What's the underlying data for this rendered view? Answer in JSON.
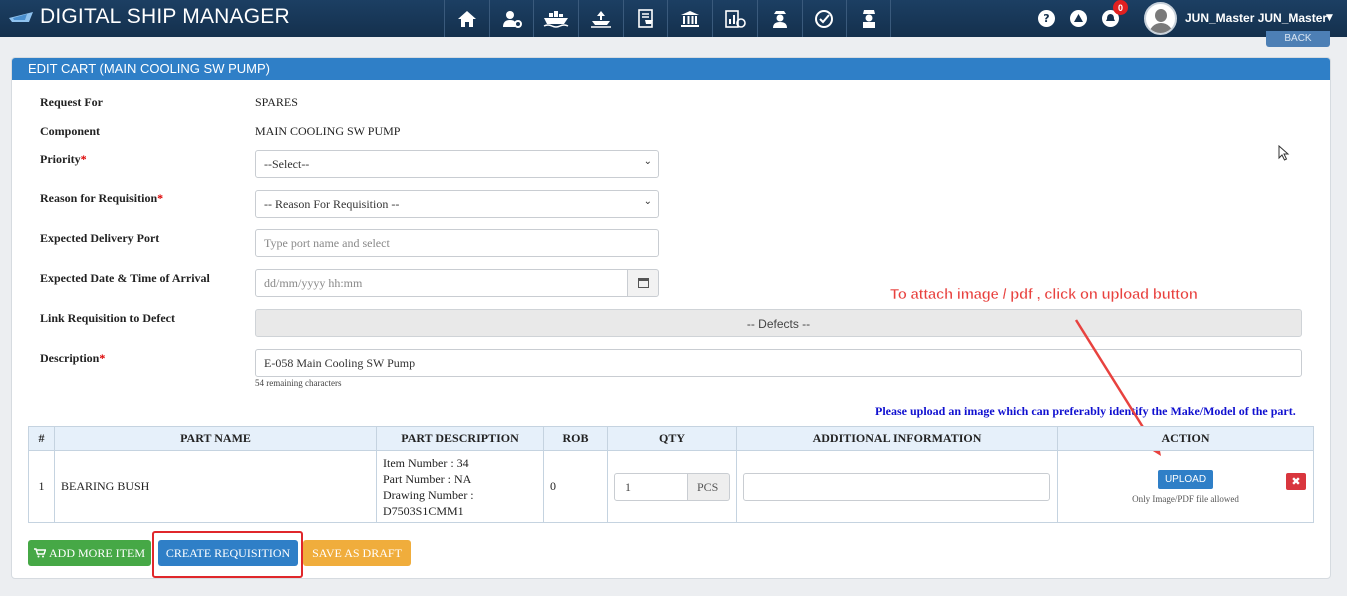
{
  "app": {
    "title": "DIGITAL SHIP MANAGER"
  },
  "nav": {
    "icons": [
      "home-icon",
      "user-settings-icon",
      "ship-icon",
      "ship-upload-icon",
      "cart-list-icon",
      "bank-icon",
      "chart-report-icon",
      "crew-icon",
      "check-badge-icon",
      "captain-icon"
    ]
  },
  "topbar": {
    "help_icon": "?",
    "alert_icon": "!",
    "notification_count": "0",
    "user_name": "JUN_Master JUN_Master",
    "back_label": "BACK"
  },
  "panel": {
    "title": "EDIT CART (MAIN COOLING SW PUMP)"
  },
  "form": {
    "request_for": {
      "label": "Request For",
      "value": "SPARES"
    },
    "component": {
      "label": "Component",
      "value": "MAIN COOLING SW PUMP"
    },
    "priority": {
      "label": "Priority",
      "required": "*",
      "value": "--Select--"
    },
    "reason": {
      "label": "Reason for Requisition",
      "required": "*",
      "value": "-- Reason For Requisition --"
    },
    "delivery_port": {
      "label": "Expected Delivery Port",
      "placeholder": "Type port name and select"
    },
    "arrival": {
      "label": "Expected Date & Time of Arrival",
      "placeholder": "dd/mm/yyyy hh:mm"
    },
    "defect": {
      "label": "Link Requisition to Defect",
      "value": "-- Defects --"
    },
    "description": {
      "label": "Description",
      "required": "*",
      "value": "E-058 Main Cooling SW Pump",
      "remaining": "54 remaining characters"
    }
  },
  "upload_hint": "Please upload an image which can preferably identify the Make/Model of the part.",
  "table": {
    "headers": [
      "#",
      "PART NAME",
      "PART DESCRIPTION",
      "ROB",
      "QTY",
      "ADDITIONAL INFORMATION",
      "ACTION"
    ],
    "rows": [
      {
        "index": "1",
        "part_name": "BEARING BUSH",
        "desc_item": "Item Number : 34",
        "desc_part": "Part Number : NA",
        "desc_drawing": "Drawing Number :",
        "desc_drawing_no": "D7503S1CMM1",
        "rob": "0",
        "qty": "1",
        "unit": "PCS",
        "upload_label": "UPLOAD",
        "upload_note": "Only Image/PDF file allowed"
      }
    ]
  },
  "buttons": {
    "add_more": "ADD MORE ITEM",
    "create": "CREATE REQUISITION",
    "draft": "SAVE AS DRAFT"
  },
  "annotation": {
    "text": "To attach image / pdf , click on upload button",
    "color": "#e8423f"
  },
  "colors": {
    "header_bg": "#14304d",
    "panel_header": "#2f7fc7",
    "green": "#46a846",
    "orange": "#f0ad3c",
    "danger": "#d9363e",
    "hint": "#1010d0"
  }
}
